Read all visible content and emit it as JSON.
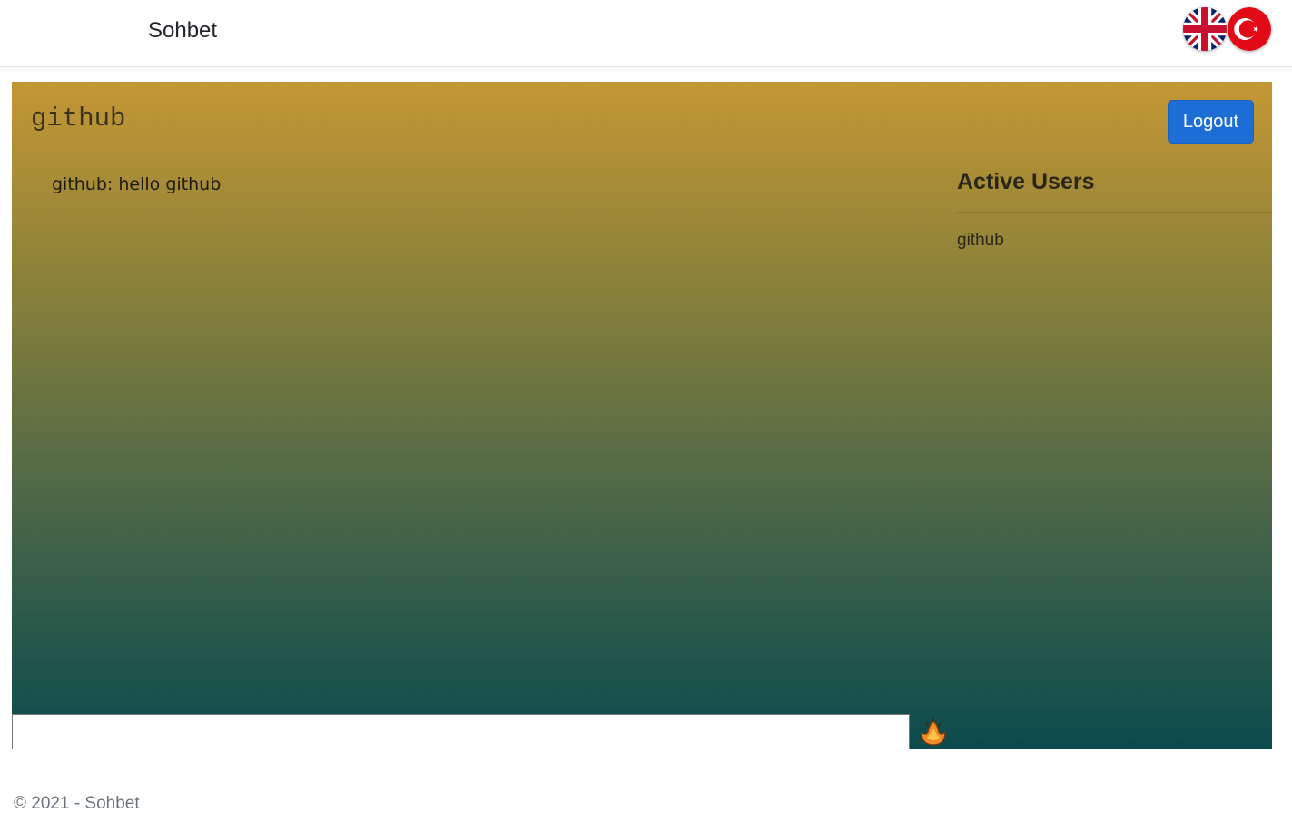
{
  "navbar": {
    "brand": "Sohbet",
    "languages": [
      {
        "code": "en",
        "icon": "uk-flag-icon"
      },
      {
        "code": "tr",
        "icon": "turkey-flag-icon"
      }
    ]
  },
  "chat": {
    "room_title": "github",
    "logout_label": "Logout",
    "messages": [
      {
        "text": "github: hello github"
      }
    ],
    "users_title": "Active Users",
    "users": [
      "github"
    ],
    "input_value": "",
    "send_icon": "send-flame-icon"
  },
  "footer": {
    "text": "© 2021 - Sohbet"
  },
  "colors": {
    "gradient_top": "#c49734",
    "gradient_bottom": "#0b4a4d",
    "logout_button": "#1c6ed6"
  }
}
